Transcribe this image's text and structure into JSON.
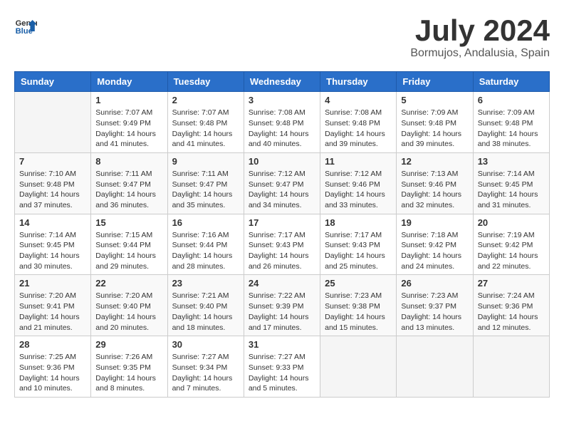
{
  "logo": {
    "general": "General",
    "blue": "Blue"
  },
  "title": "July 2024",
  "location": "Bormujos, Andalusia, Spain",
  "weekdays": [
    "Sunday",
    "Monday",
    "Tuesday",
    "Wednesday",
    "Thursday",
    "Friday",
    "Saturday"
  ],
  "weeks": [
    [
      {
        "day": "",
        "info": ""
      },
      {
        "day": "1",
        "info": "Sunrise: 7:07 AM\nSunset: 9:49 PM\nDaylight: 14 hours and 41 minutes."
      },
      {
        "day": "2",
        "info": "Sunrise: 7:07 AM\nSunset: 9:48 PM\nDaylight: 14 hours and 41 minutes."
      },
      {
        "day": "3",
        "info": "Sunrise: 7:08 AM\nSunset: 9:48 PM\nDaylight: 14 hours and 40 minutes."
      },
      {
        "day": "4",
        "info": "Sunrise: 7:08 AM\nSunset: 9:48 PM\nDaylight: 14 hours and 39 minutes."
      },
      {
        "day": "5",
        "info": "Sunrise: 7:09 AM\nSunset: 9:48 PM\nDaylight: 14 hours and 39 minutes."
      },
      {
        "day": "6",
        "info": "Sunrise: 7:09 AM\nSunset: 9:48 PM\nDaylight: 14 hours and 38 minutes."
      }
    ],
    [
      {
        "day": "7",
        "info": "Sunrise: 7:10 AM\nSunset: 9:48 PM\nDaylight: 14 hours and 37 minutes."
      },
      {
        "day": "8",
        "info": "Sunrise: 7:11 AM\nSunset: 9:47 PM\nDaylight: 14 hours and 36 minutes."
      },
      {
        "day": "9",
        "info": "Sunrise: 7:11 AM\nSunset: 9:47 PM\nDaylight: 14 hours and 35 minutes."
      },
      {
        "day": "10",
        "info": "Sunrise: 7:12 AM\nSunset: 9:47 PM\nDaylight: 14 hours and 34 minutes."
      },
      {
        "day": "11",
        "info": "Sunrise: 7:12 AM\nSunset: 9:46 PM\nDaylight: 14 hours and 33 minutes."
      },
      {
        "day": "12",
        "info": "Sunrise: 7:13 AM\nSunset: 9:46 PM\nDaylight: 14 hours and 32 minutes."
      },
      {
        "day": "13",
        "info": "Sunrise: 7:14 AM\nSunset: 9:45 PM\nDaylight: 14 hours and 31 minutes."
      }
    ],
    [
      {
        "day": "14",
        "info": "Sunrise: 7:14 AM\nSunset: 9:45 PM\nDaylight: 14 hours and 30 minutes."
      },
      {
        "day": "15",
        "info": "Sunrise: 7:15 AM\nSunset: 9:44 PM\nDaylight: 14 hours and 29 minutes."
      },
      {
        "day": "16",
        "info": "Sunrise: 7:16 AM\nSunset: 9:44 PM\nDaylight: 14 hours and 28 minutes."
      },
      {
        "day": "17",
        "info": "Sunrise: 7:17 AM\nSunset: 9:43 PM\nDaylight: 14 hours and 26 minutes."
      },
      {
        "day": "18",
        "info": "Sunrise: 7:17 AM\nSunset: 9:43 PM\nDaylight: 14 hours and 25 minutes."
      },
      {
        "day": "19",
        "info": "Sunrise: 7:18 AM\nSunset: 9:42 PM\nDaylight: 14 hours and 24 minutes."
      },
      {
        "day": "20",
        "info": "Sunrise: 7:19 AM\nSunset: 9:42 PM\nDaylight: 14 hours and 22 minutes."
      }
    ],
    [
      {
        "day": "21",
        "info": "Sunrise: 7:20 AM\nSunset: 9:41 PM\nDaylight: 14 hours and 21 minutes."
      },
      {
        "day": "22",
        "info": "Sunrise: 7:20 AM\nSunset: 9:40 PM\nDaylight: 14 hours and 20 minutes."
      },
      {
        "day": "23",
        "info": "Sunrise: 7:21 AM\nSunset: 9:40 PM\nDaylight: 14 hours and 18 minutes."
      },
      {
        "day": "24",
        "info": "Sunrise: 7:22 AM\nSunset: 9:39 PM\nDaylight: 14 hours and 17 minutes."
      },
      {
        "day": "25",
        "info": "Sunrise: 7:23 AM\nSunset: 9:38 PM\nDaylight: 14 hours and 15 minutes."
      },
      {
        "day": "26",
        "info": "Sunrise: 7:23 AM\nSunset: 9:37 PM\nDaylight: 14 hours and 13 minutes."
      },
      {
        "day": "27",
        "info": "Sunrise: 7:24 AM\nSunset: 9:36 PM\nDaylight: 14 hours and 12 minutes."
      }
    ],
    [
      {
        "day": "28",
        "info": "Sunrise: 7:25 AM\nSunset: 9:36 PM\nDaylight: 14 hours and 10 minutes."
      },
      {
        "day": "29",
        "info": "Sunrise: 7:26 AM\nSunset: 9:35 PM\nDaylight: 14 hours and 8 minutes."
      },
      {
        "day": "30",
        "info": "Sunrise: 7:27 AM\nSunset: 9:34 PM\nDaylight: 14 hours and 7 minutes."
      },
      {
        "day": "31",
        "info": "Sunrise: 7:27 AM\nSunset: 9:33 PM\nDaylight: 14 hours and 5 minutes."
      },
      {
        "day": "",
        "info": ""
      },
      {
        "day": "",
        "info": ""
      },
      {
        "day": "",
        "info": ""
      }
    ]
  ]
}
